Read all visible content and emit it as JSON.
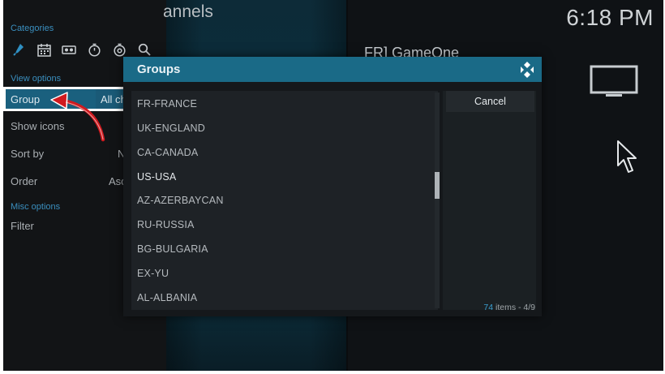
{
  "header": {
    "title": "annels",
    "clock": "6:18 PM"
  },
  "channel": {
    "name": "FR] GameOne"
  },
  "sidebar": {
    "categories_label": "Categories",
    "category_icons": [
      "brush-icon",
      "calendar-icon",
      "ticket-icon",
      "timer-icon",
      "timer-alt-icon",
      "search-icon"
    ],
    "view_options_label": "View options",
    "options": [
      {
        "label": "Group",
        "value": "All ch"
      },
      {
        "label": "Show icons",
        "value": ""
      },
      {
        "label": "Sort by",
        "value": "N"
      },
      {
        "label": "Order",
        "value": "Asc"
      }
    ],
    "misc_options_label": "Misc options",
    "filter_label": "Filter"
  },
  "dialog": {
    "title": "Groups",
    "items": [
      "FR-FRANCE",
      "UK-ENGLAND",
      "CA-CANADA",
      "US-USA",
      "AZ-AZERBAYCAN",
      "RU-RUSSIA",
      "BG-BULGARIA",
      "EX-YU",
      "AL-ALBANIA"
    ],
    "focused_item": "US-USA",
    "cancel_label": "Cancel",
    "count_number": "74",
    "count_rest": " items - 4/9"
  },
  "colors": {
    "accent": "#1a6a87",
    "section_head": "#3a8fbf",
    "annotation_arrow": "#d01a1f"
  }
}
